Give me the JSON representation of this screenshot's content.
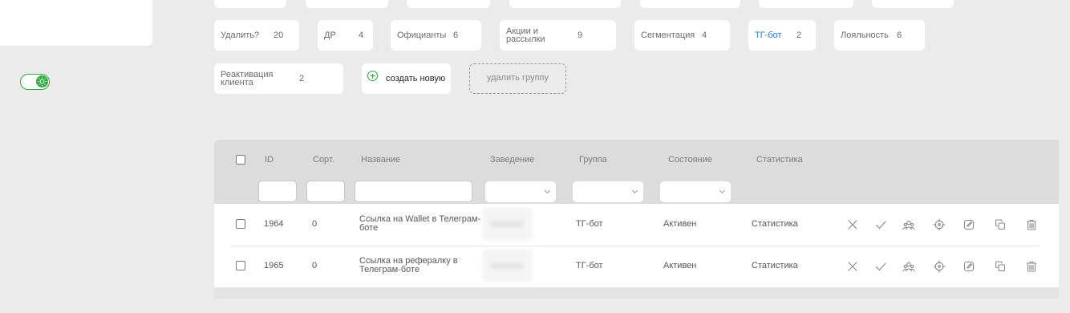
{
  "groups": {
    "chips": [
      {
        "label": "Удалить?",
        "count": "20"
      },
      {
        "label": "ДР",
        "count": "4"
      },
      {
        "label": "Официанты",
        "count": "6"
      },
      {
        "label": "Акции и рассылки",
        "count": "9"
      },
      {
        "label": "Сегментация",
        "count": "4"
      },
      {
        "label": "ТГ-бот",
        "count": "2",
        "active": true
      },
      {
        "label": "Лояльность",
        "count": "6"
      },
      {
        "label": "Реактивация клиента",
        "count": "2"
      }
    ],
    "create_label": "создать новую",
    "delete_group_label": "удалить группу"
  },
  "table": {
    "columns": {
      "id": "ID",
      "sort": "Сорт.",
      "name": "Название",
      "venue": "Заведение",
      "group": "Группа",
      "state": "Состояние",
      "stats": "Статистика"
    },
    "rows": [
      {
        "id": "1964",
        "sort": "0",
        "name": "Ссылка на Wallet в Телеграм-боте",
        "group": "ТГ-бот",
        "state": "Активен",
        "stats": "Статистика"
      },
      {
        "id": "1965",
        "sort": "0",
        "name": "Ссылка на рефералку в Телеграм-боте",
        "group": "ТГ-бот",
        "state": "Активен",
        "stats": "Статистика"
      }
    ],
    "row_actions": [
      "close-icon",
      "check-icon",
      "users-icon",
      "target-icon",
      "edit-icon",
      "copy-icon",
      "trash-icon"
    ]
  },
  "colors": {
    "accent_green": "#2eaa3c",
    "active_link": "#2979c9",
    "background": "#ebebeb"
  }
}
